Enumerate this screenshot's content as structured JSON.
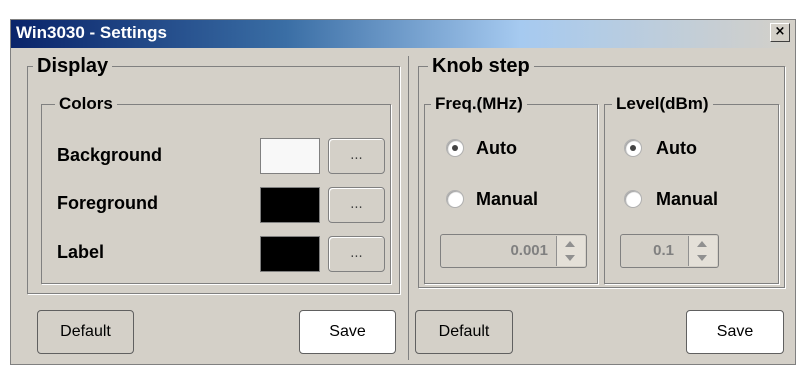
{
  "window": {
    "title": "Win3030 - Settings",
    "close_icon": "×"
  },
  "display": {
    "title": "Display",
    "colors": {
      "title": "Colors",
      "rows": [
        {
          "label": "Background",
          "color": "#f8f8f8",
          "button": "..."
        },
        {
          "label": "Foreground",
          "color": "#000000",
          "button": "..."
        },
        {
          "label": "Label",
          "color": "#000000",
          "button": "..."
        }
      ]
    },
    "default_label": "Default",
    "save_label": "Save"
  },
  "knob": {
    "title": "Knob step",
    "freq": {
      "title": "Freq.(MHz)",
      "auto_label": "Auto",
      "manual_label": "Manual",
      "selected": "Auto",
      "value": "0.001"
    },
    "level": {
      "title": "Level(dBm)",
      "auto_label": "Auto",
      "manual_label": "Manual",
      "selected": "Auto",
      "value": "0.1"
    },
    "default_label": "Default",
    "save_label": "Save"
  }
}
